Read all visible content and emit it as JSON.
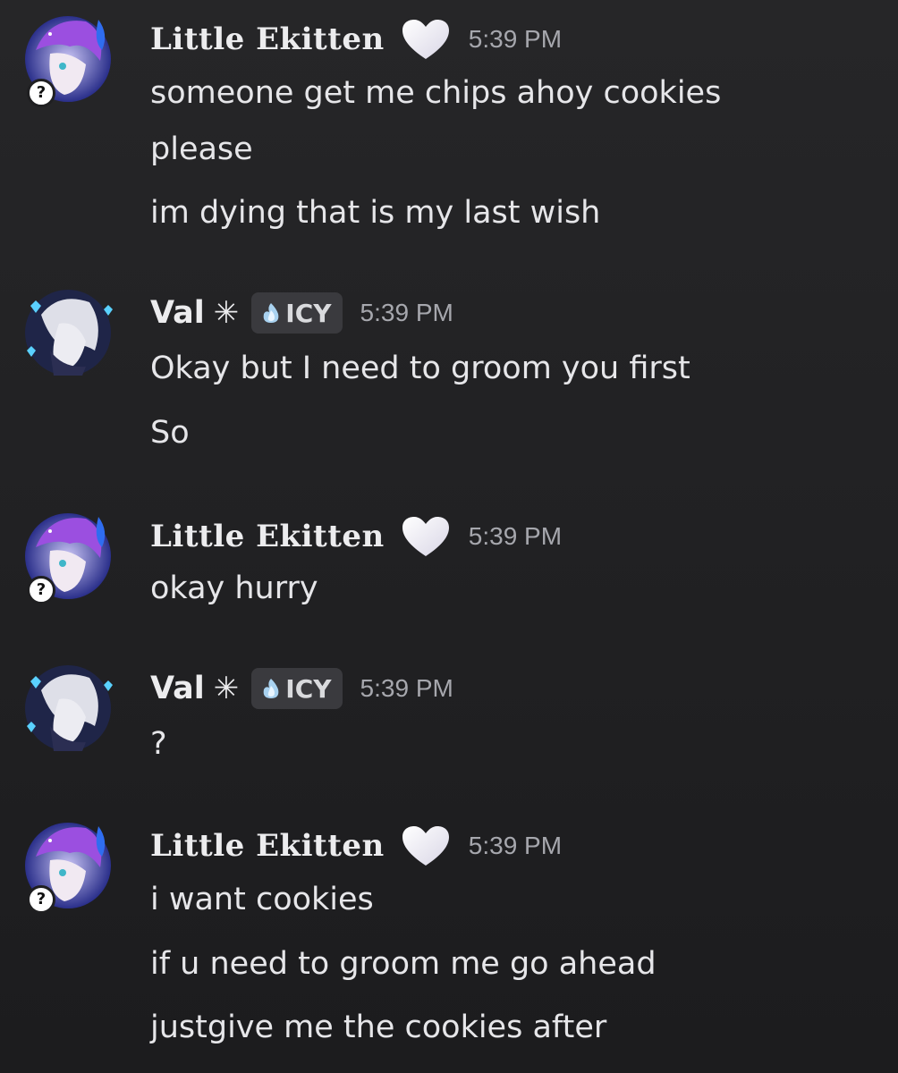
{
  "messages": [
    {
      "author": "Little Ekitten",
      "author_icon": "white-heart-icon",
      "time": "5:39 PM",
      "lines": [
        "someone get me chips ahoy cookies",
        "please",
        "im dying that is my last wish"
      ]
    },
    {
      "author": "Val",
      "author_icon": "asterisk-icon",
      "author_symbol": "✳",
      "role": "ICY",
      "role_icon": "ice-flame-icon",
      "time": "5:39 PM",
      "lines": [
        "Okay but I need to groom you first",
        "So"
      ]
    },
    {
      "author": "Little Ekitten",
      "author_icon": "white-heart-icon",
      "time": "5:39 PM",
      "lines": [
        "okay hurry"
      ]
    },
    {
      "author": "Val",
      "author_icon": "asterisk-icon",
      "author_symbol": "✳",
      "role": "ICY",
      "role_icon": "ice-flame-icon",
      "time": "5:39 PM",
      "lines": [
        "?"
      ]
    },
    {
      "author": "Little Ekitten",
      "author_icon": "white-heart-icon",
      "time": "5:39 PM",
      "lines": [
        "i want cookies",
        "if u need to groom me go ahead",
        "justgive me the cookies after"
      ]
    }
  ],
  "avatar_badge": "?",
  "colors": {
    "background": "#222224",
    "text": "#e6e6e9",
    "timestamp": "#a6a7ad",
    "role_tag": "#3a3a3e"
  }
}
